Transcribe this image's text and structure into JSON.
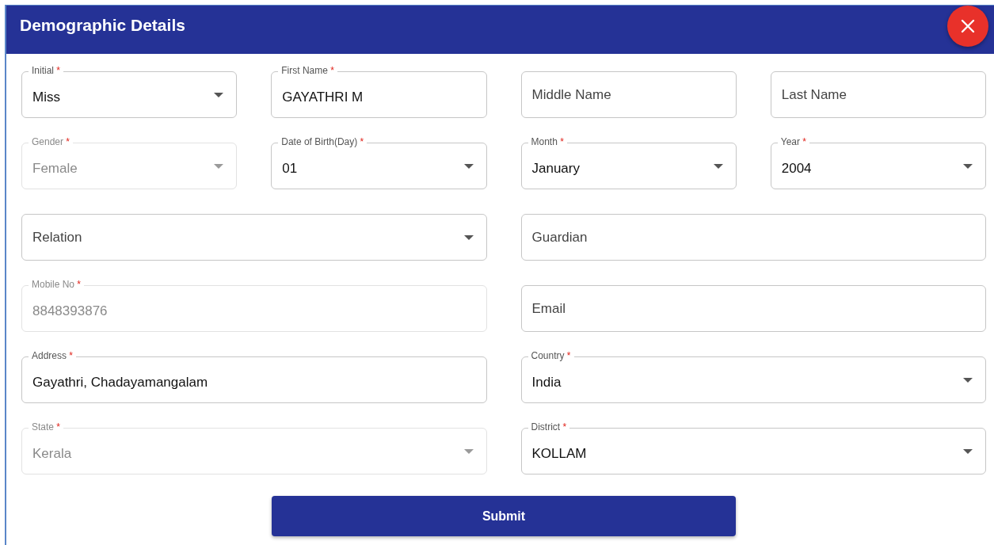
{
  "dialog": {
    "title": "Demographic Details",
    "close_button": {
      "kind": "close"
    }
  },
  "rows": [
    [
      {
        "kind": "select",
        "label": "Initial",
        "mark": "*",
        "value": "Miss",
        "disabled": false
      },
      {
        "kind": "text",
        "label": "First Name",
        "mark": "*",
        "value": "GAYATHRI M",
        "disabled": false
      },
      {
        "kind": "text",
        "placeholder": "Middle Name",
        "disabled": false
      },
      {
        "kind": "text",
        "placeholder": "Last Name",
        "disabled": false
      }
    ],
    [
      {
        "kind": "select",
        "label": "Gender",
        "mark": "*",
        "value": "Female",
        "disabled": true
      },
      {
        "kind": "select",
        "label": "Date of Birth(Day)",
        "mark": "*",
        "value": "01",
        "disabled": false
      },
      {
        "kind": "select",
        "label": "Month",
        "mark": "*",
        "value": "January",
        "disabled": false
      },
      {
        "kind": "select",
        "label": "Year",
        "mark": "*",
        "value": "2004",
        "disabled": false
      }
    ],
    [
      {
        "kind": "select",
        "placeholder": "Relation",
        "disabled": false
      },
      {
        "kind": "text",
        "placeholder": "Guardian",
        "disabled": false
      }
    ],
    [
      {
        "kind": "text",
        "label": "Mobile No",
        "mark": "*",
        "value": "8848393876",
        "disabled": true
      },
      {
        "kind": "text",
        "placeholder": "Email",
        "disabled": false
      }
    ],
    [
      {
        "kind": "text",
        "label": "Address",
        "mark": "*",
        "value": "Gayathri, Chadayamangalam",
        "disabled": false
      },
      {
        "kind": "select",
        "label": "Country",
        "mark": "*",
        "value": "India",
        "disabled": false
      }
    ],
    [
      {
        "kind": "select",
        "label": "State",
        "mark": "*",
        "value": "Kerala",
        "disabled": true
      },
      {
        "kind": "select",
        "label": "District",
        "mark": "*",
        "value": "KOLLAM",
        "disabled": false
      }
    ]
  ],
  "submit_button": {
    "label": "Submit"
  }
}
